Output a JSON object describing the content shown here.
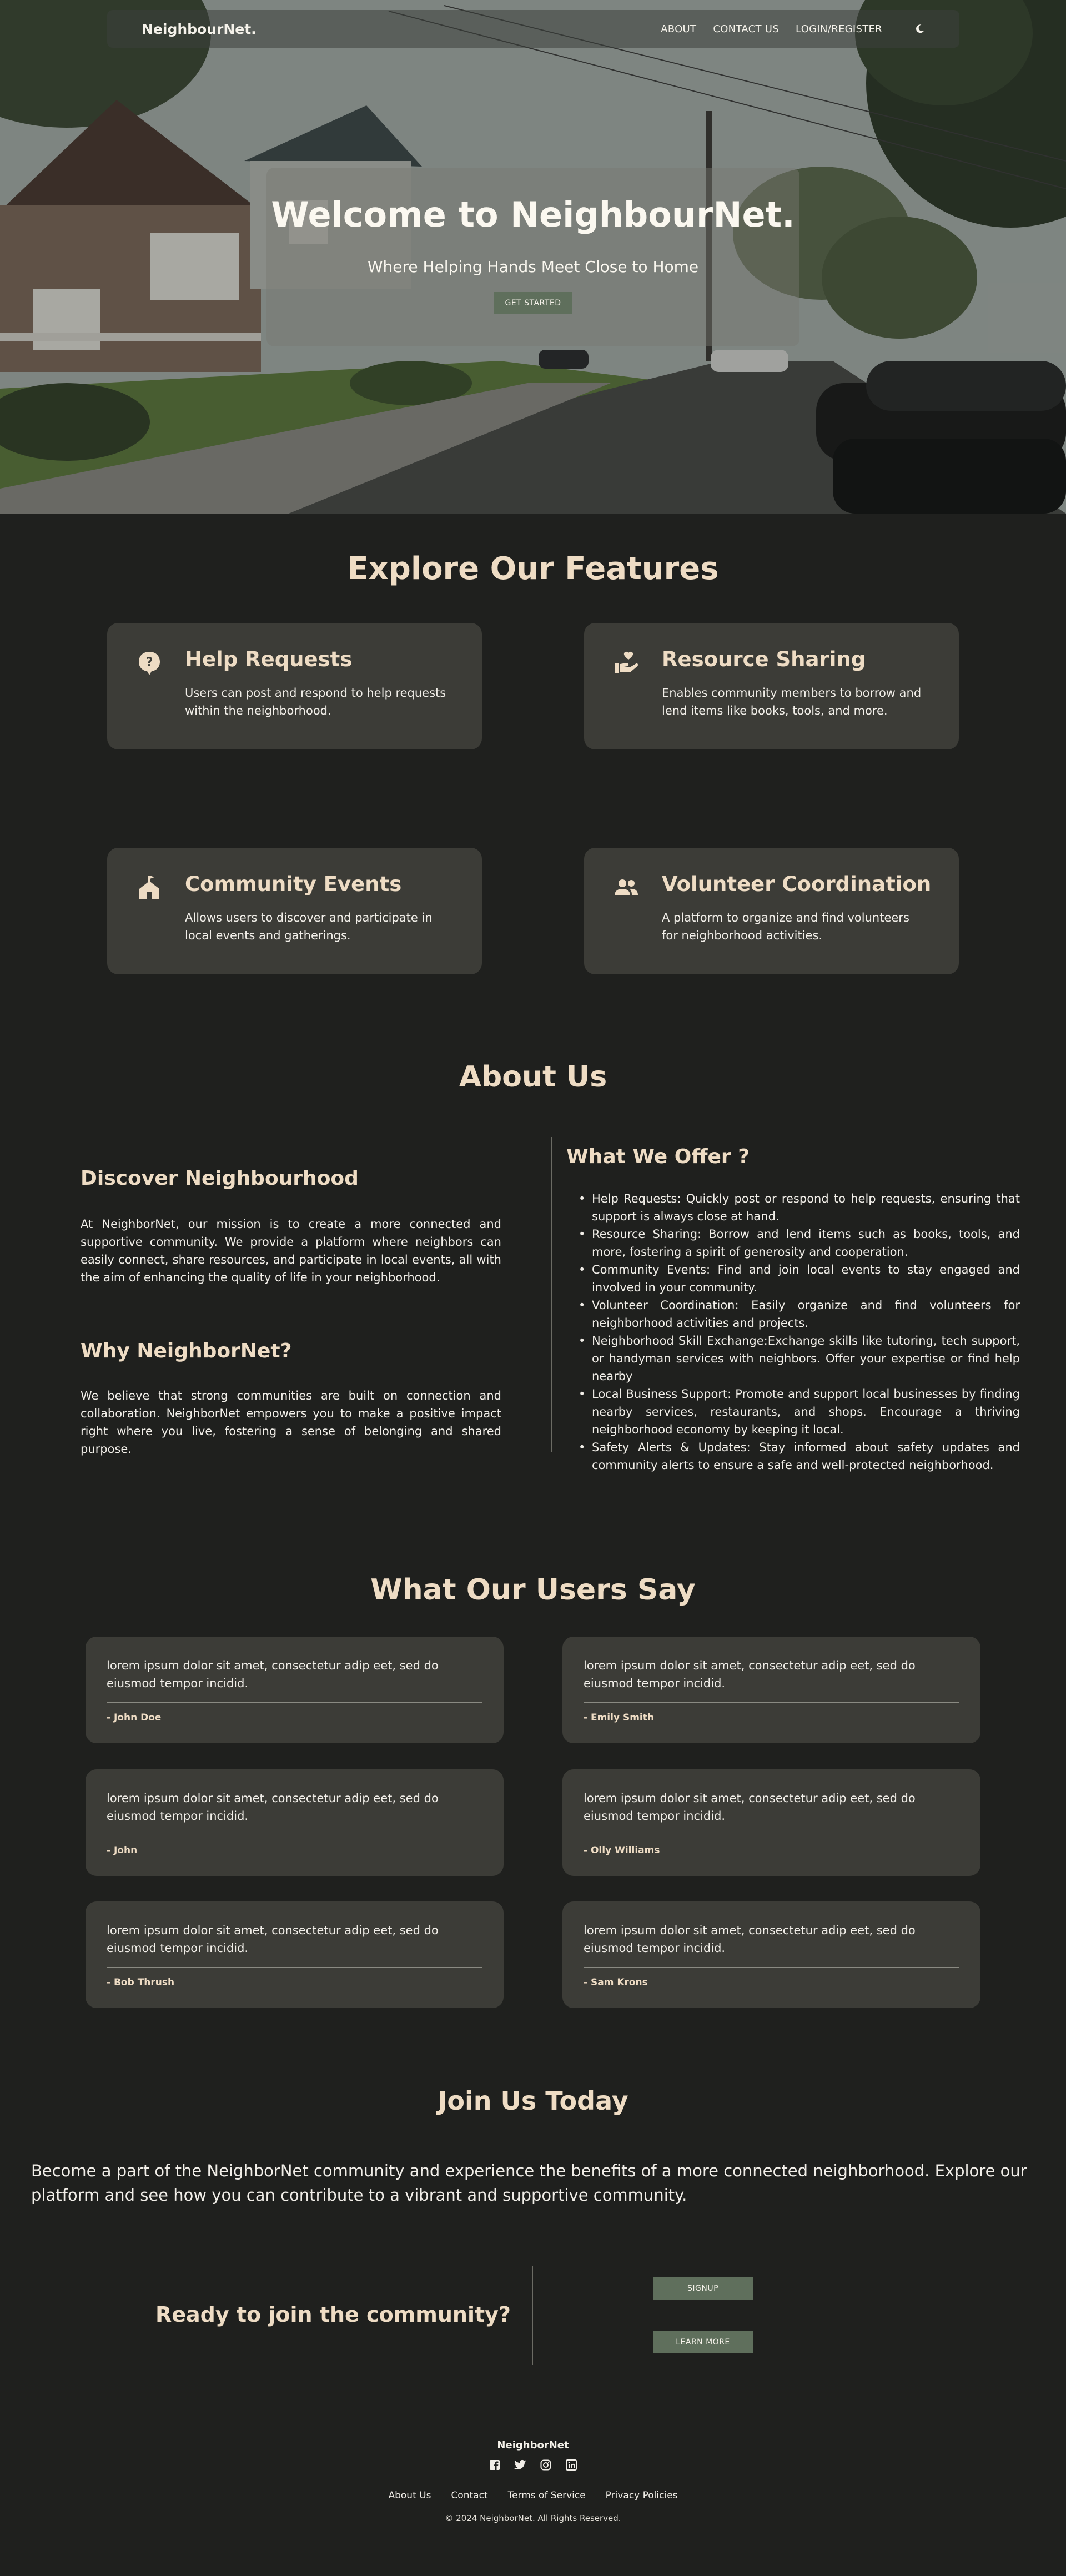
{
  "nav": {
    "brand": "NeighbourNet.",
    "links": [
      "ABOUT",
      "CONTACT US",
      "LOGIN/REGISTER"
    ],
    "theme_icon": "moon-icon"
  },
  "hero": {
    "title": "Welcome to NeighbourNet.",
    "subtitle": "Where Helping Hands Meet Close to Home",
    "button": "GET STARTED"
  },
  "features": {
    "title": "Explore Our Features",
    "items": [
      {
        "icon": "question-bubble-icon",
        "title": "Help Requests",
        "desc": "Users can post and respond to help requests within the neighborhood."
      },
      {
        "icon": "hand-heart-icon",
        "title": "Resource Sharing",
        "desc": "Enables community members to borrow and lend items like books, tools, and more."
      },
      {
        "icon": "community-house-icon",
        "title": "Community Events",
        "desc": "Allows users to discover and participate in local events and gatherings."
      },
      {
        "icon": "people-group-icon",
        "title": "Volunteer Coordination",
        "desc": "A platform to organize and find volunteers for neighborhood activities."
      }
    ]
  },
  "about": {
    "title": "About Us",
    "discover_title": "Discover Neighbourhood",
    "discover_text": "At NeighborNet, our mission is to create a more connected and supportive community. We provide a platform where neighbors can easily connect, share resources, and participate in local events, all with the aim of enhancing the quality of life in your neighborhood.",
    "why_title": "Why NeighborNet?",
    "why_text": "We believe that strong communities are built on connection and collaboration. NeighborNet empowers you to make a positive impact right where you live, fostering a sense of belonging and shared purpose.",
    "offer_title": "What We Offer ?",
    "offers": [
      "Help Requests: Quickly post or respond to help requests, ensuring that support is always close at hand.",
      "Resource Sharing: Borrow and lend items such as books, tools, and more, fostering a spirit of generosity and cooperation.",
      "Community Events: Find and join local events to stay engaged and involved in your community.",
      "Volunteer Coordination: Easily organize and find volunteers for neighborhood activities and projects.",
      "Neighborhood Skill Exchange:Exchange skills like tutoring, tech support, or handyman services with neighbors. Offer your expertise or find help nearby",
      "Local Business Support: Promote and support local businesses by finding nearby services, restaurants, and shops. Encourage a thriving neighborhood economy by keeping it local.",
      "Safety Alerts & Updates: Stay informed about safety updates and community alerts to ensure a safe and well-protected neighborhood."
    ]
  },
  "testimonials": {
    "title": "What Our Users Say",
    "items": [
      {
        "text": "lorem ipsum dolor sit amet, consectetur adip eet, sed do eiusmod tempor incidid.",
        "author": "- John Doe"
      },
      {
        "text": "lorem ipsum dolor sit amet, consectetur adip eet, sed do eiusmod tempor incidid.",
        "author": "- Emily Smith"
      },
      {
        "text": "lorem ipsum dolor sit amet, consectetur adip eet, sed do eiusmod tempor incidid.",
        "author": "- John"
      },
      {
        "text": "lorem ipsum dolor sit amet, consectetur adip eet, sed do eiusmod tempor incidid.",
        "author": "- Olly Williams"
      },
      {
        "text": "lorem ipsum dolor sit amet, consectetur adip eet, sed do eiusmod tempor incidid.",
        "author": "- Bob Thrush"
      },
      {
        "text": "lorem ipsum dolor sit amet, consectetur adip eet, sed do eiusmod tempor incidid.",
        "author": "- Sam Krons"
      }
    ]
  },
  "join": {
    "title": "Join Us Today",
    "text": "Become a part of the NeighborNet community and experience the benefits of a more connected neighborhood. Explore our platform and see how you can contribute to a vibrant and supportive community.",
    "cta_title": "Ready to join the community?",
    "signup": "SIGNUP",
    "learn_more": "LEARN MORE"
  },
  "footer": {
    "brand": "NeighborNet",
    "socials": [
      "facebook-icon",
      "twitter-icon",
      "instagram-icon",
      "linkedin-icon"
    ],
    "links": [
      "About Us",
      "Contact",
      "Terms of Service",
      "Privacy Policies"
    ],
    "copyright": "© 2024 NeighborNet. All Rights Reserved."
  },
  "colors": {
    "background": "#1f201e",
    "card": "#3c3c37",
    "accent_text": "#eedcc4",
    "button": "#5f6f5c"
  }
}
